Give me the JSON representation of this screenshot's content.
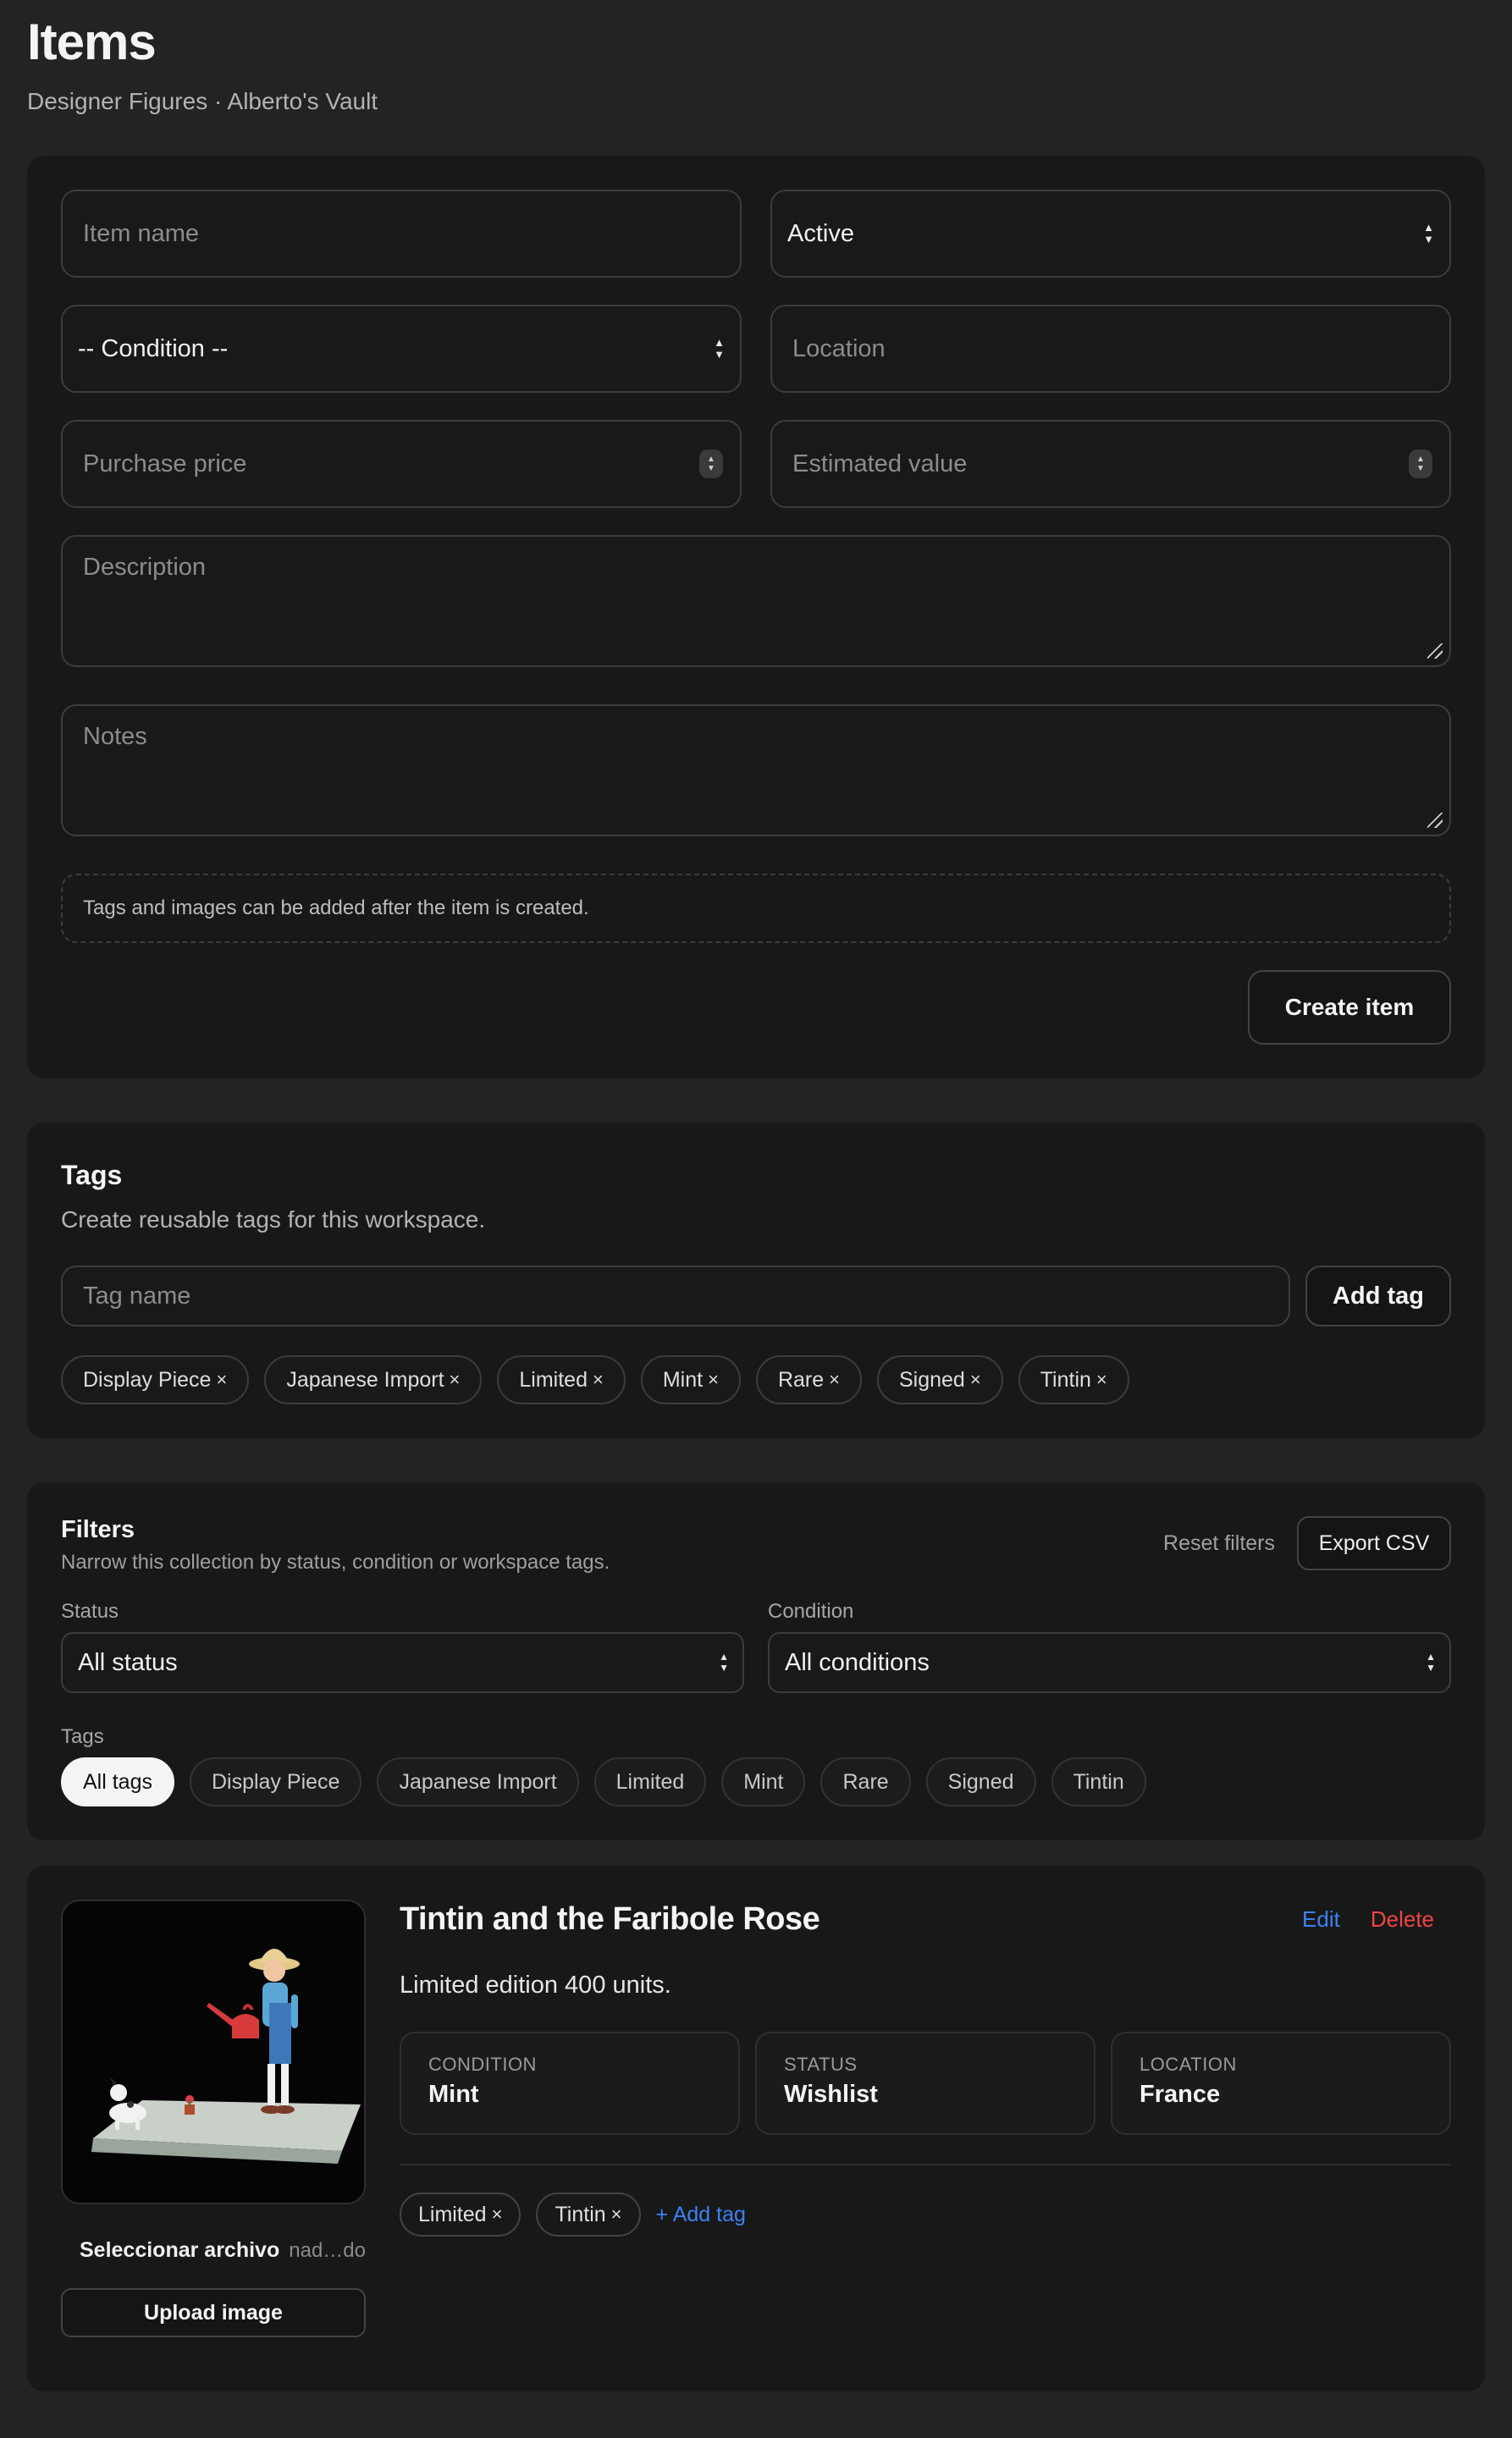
{
  "page": {
    "title": "Items",
    "subtitle": "Designer Figures · Alberto's Vault"
  },
  "create_form": {
    "item_name_placeholder": "Item name",
    "status_value": "Active",
    "condition_value": "-- Condition --",
    "location_placeholder": "Location",
    "purchase_price_placeholder": "Purchase price",
    "estimated_value_placeholder": "Estimated value",
    "description_placeholder": "Description",
    "notes_placeholder": "Notes",
    "hint": "Tags and images can be added after the item is created.",
    "submit_label": "Create item"
  },
  "tags_section": {
    "title": "Tags",
    "subtitle": "Create reusable tags for this workspace.",
    "input_placeholder": "Tag name",
    "add_label": "Add tag",
    "tags": [
      "Display Piece",
      "Japanese Import",
      "Limited",
      "Mint",
      "Rare",
      "Signed",
      "Tintin"
    ]
  },
  "filters": {
    "title": "Filters",
    "subtitle": "Narrow this collection by status, condition or workspace tags.",
    "reset_label": "Reset filters",
    "export_label": "Export CSV",
    "status_label": "Status",
    "status_value": "All status",
    "condition_label": "Condition",
    "condition_value": "All conditions",
    "tags_label": "Tags",
    "tag_options": [
      "All tags",
      "Display Piece",
      "Japanese Import",
      "Limited",
      "Mint",
      "Rare",
      "Signed",
      "Tintin"
    ],
    "active_tag": "All tags"
  },
  "item": {
    "title": "Tintin and the Faribole Rose",
    "edit_label": "Edit",
    "delete_label": "Delete",
    "description": "Limited edition 400 units.",
    "condition_label": "CONDITION",
    "condition_value": "Mint",
    "status_label": "STATUS",
    "status_value": "Wishlist",
    "location_label": "LOCATION",
    "location_value": "France",
    "tags": [
      "Limited",
      "Tintin"
    ],
    "add_tag_label": "+ Add tag",
    "file_button_label": "Seleccionar archivo",
    "file_name": "nad…do",
    "upload_label": "Upload image"
  },
  "icons": {
    "remove": "×",
    "select_caret": "up-down-chevron-icon",
    "number_spinner": "spinner-icon"
  },
  "colors": {
    "background": "#232323",
    "card": "#181818",
    "link_blue": "#3b82f6",
    "danger_red": "#ef4444"
  }
}
